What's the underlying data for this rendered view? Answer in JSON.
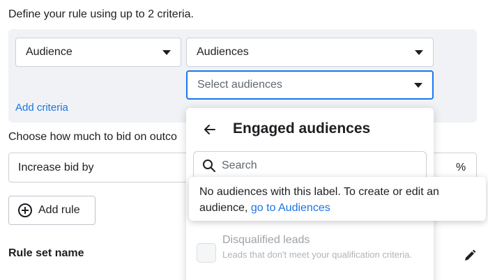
{
  "intro": "Define your rule using up to 2 criteria.",
  "criteria": {
    "field1": {
      "value": "Audience"
    },
    "field2": {
      "value": "Audiences"
    },
    "field3": {
      "placeholder": "Select audiences"
    },
    "add_criteria": "Add criteria"
  },
  "bid": {
    "prompt": "Choose how much to bid on outco",
    "action": "Increase bid by",
    "unit": "%"
  },
  "add_rule": "Add rule",
  "rule_set_name": "Rule set name",
  "dropdown": {
    "title": "Engaged audiences",
    "search_placeholder": "Search",
    "items": [
      {
        "title": "Disqualified leads",
        "description": "Leads that don't meet your qualification criteria."
      }
    ]
  },
  "tooltip": {
    "text": "No audiences with this label. To create or edit an audience, ",
    "link": "go to Audiences"
  },
  "colors": {
    "accent": "#1b74e4",
    "focus_border": "#1877f2",
    "panel_bg": "#f0f2f5"
  },
  "icons": [
    "chevron-down-icon",
    "back-arrow-icon",
    "search-icon",
    "plus-circle-icon",
    "pencil-icon"
  ]
}
